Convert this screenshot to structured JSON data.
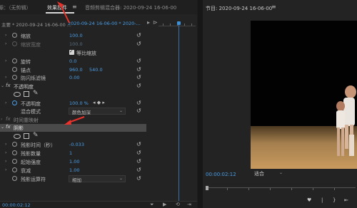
{
  "left_panel": {
    "tabs": [
      {
        "label": "源：（无剪辑）",
        "active": false
      },
      {
        "label": "效果控件",
        "active": true
      },
      {
        "label": "音频剪辑混合器: 2020-09-24 16-06-00",
        "active": false
      }
    ],
    "menu_glyph": "≡",
    "clip_master": "主要 * 2020-09-24 16-06-00 ...",
    "clip_sequence": "2020-09-24 16-06-00 * 2020-...",
    "rows": [
      {
        "label": "缩放",
        "value": "100.0",
        "dim": false
      },
      {
        "label": "缩放宽度",
        "value": "100.0",
        "dim": true
      },
      {
        "label": "旋转",
        "value": "0.0",
        "dim": false
      },
      {
        "label": "锚点",
        "value": "960.0",
        "value2": "540.0",
        "dim": false
      },
      {
        "label": "防闪烁滤镜",
        "value": "0.00",
        "dim": false
      }
    ],
    "uniform_scale": "等比缩放",
    "opacity_section": "不透明度",
    "opacity_label": "不透明度",
    "opacity_value": "100.0 %",
    "blend_label": "混合模式",
    "blend_value": "颜色加深",
    "time_remap": "时间重映射",
    "shadow_section": "阴影",
    "shadow_rows": [
      {
        "label": "残影时间（秒）",
        "value": "-0.033"
      },
      {
        "label": "残影数量",
        "value": "1"
      },
      {
        "label": "起始强度",
        "value": "1.00"
      },
      {
        "label": "衰减",
        "value": "1.00"
      }
    ],
    "echo_op_label": "残影运算符",
    "echo_op_value": "相加",
    "footer_time": "00:00:02:12"
  },
  "right_panel": {
    "title": "节目: 2020-09-24 16-06-00",
    "menu_glyph": "≡",
    "timecode": "00:00:02:12",
    "fit_label": "适合"
  },
  "colors": {
    "accent": "#4a9fe8",
    "annotation_arrow": "#e8322b"
  }
}
